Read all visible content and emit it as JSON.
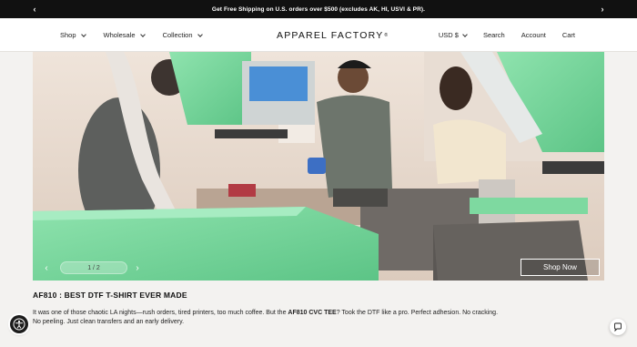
{
  "announcement": {
    "text": "Get Free Shipping on U.S. orders over $500 (excludes AK, HI, USVI & PR).",
    "prev_icon": "chevron-left-icon",
    "next_icon": "chevron-right-icon"
  },
  "header": {
    "nav_left": [
      {
        "label": "Shop",
        "has_dropdown": true
      },
      {
        "label": "Wholesale",
        "has_dropdown": true
      },
      {
        "label": "Collection",
        "has_dropdown": true
      }
    ],
    "logo": {
      "text": "APPAREL FACTORY",
      "mark": "®"
    },
    "currency": "USD $",
    "search_label": "Search",
    "account_label": "Account",
    "cart_label": "Cart"
  },
  "hero": {
    "slide_counter": "1 / 2",
    "current_slide": 1,
    "total_slides": 2,
    "shop_now_label": "Shop Now"
  },
  "post": {
    "title": "AF810 : BEST DTF T-SHIRT EVER MADE",
    "body_part1": "It was one of those chaotic LA nights—rush orders, tired printers, too much coffee. But the ",
    "body_bold": "AF810 CVC TEE",
    "body_part2": "? Took the DTF like a pro. Perfect adhesion. No cracking. No peeling. Just clean transfers and an early delivery."
  },
  "widgets": {
    "accessibility_icon": "accessibility-icon",
    "chat_icon": "chat-icon"
  },
  "colors": {
    "press_green": "#7ed9a0",
    "announcement_bg": "#111111",
    "page_bg": "#f3f2f0"
  }
}
